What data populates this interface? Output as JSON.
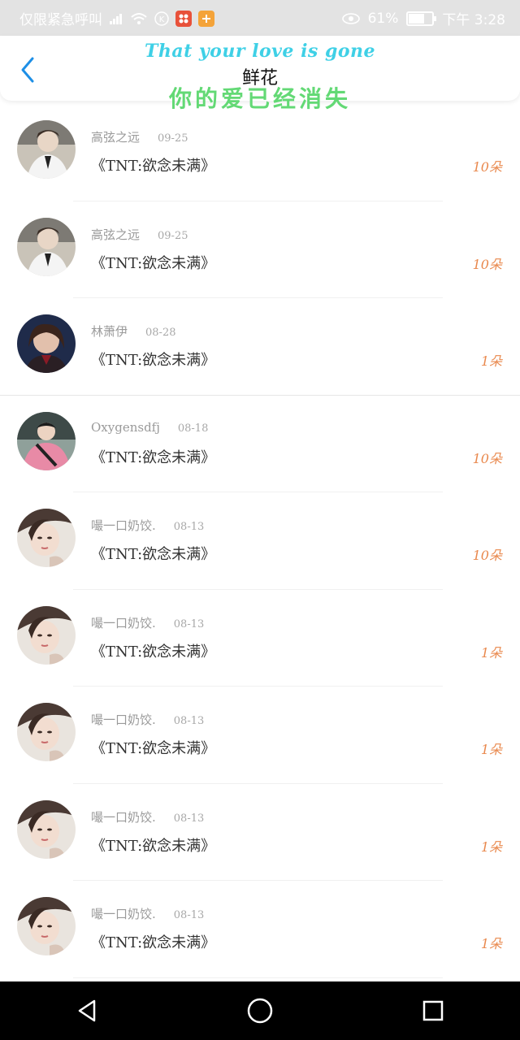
{
  "status_bar": {
    "carrier": "仅限紧急呼叫",
    "battery_text": "61%",
    "battery_level": 0.61,
    "time": "下午 3:28",
    "icons": [
      "signal-icon",
      "wifi-icon",
      "k-circle-icon",
      "app-badge-red",
      "app-badge-orange",
      "eye-icon",
      "battery-icon"
    ]
  },
  "header": {
    "title_en": "That your love is gone",
    "title": "鲜花",
    "title_cn": "你的爱已经消失",
    "accent_colors": {
      "en": "#3fd0e6",
      "cn": "#63d975",
      "back": "#1e8fe6"
    }
  },
  "items": [
    {
      "name": "高弦之远",
      "date": "09-25",
      "song": "《TNT:欲念未满》",
      "count": "10朵",
      "avatar": "avatar-1"
    },
    {
      "name": "高弦之远",
      "date": "09-25",
      "song": "《TNT:欲念未满》",
      "count": "10朵",
      "avatar": "avatar-1"
    },
    {
      "name": "林萧伊",
      "date": "08-28",
      "song": "《TNT:欲念未满》",
      "count": "1朵",
      "avatar": "avatar-2"
    },
    {
      "name": "Oxygensdfj",
      "date": "08-18",
      "song": "《TNT:欲念未满》",
      "count": "10朵",
      "avatar": "avatar-3"
    },
    {
      "name": "嘬一口奶饺.",
      "date": "08-13",
      "song": "《TNT:欲念未满》",
      "count": "10朵",
      "avatar": "avatar-4"
    },
    {
      "name": "嘬一口奶饺.",
      "date": "08-13",
      "song": "《TNT:欲念未满》",
      "count": "1朵",
      "avatar": "avatar-4"
    },
    {
      "name": "嘬一口奶饺.",
      "date": "08-13",
      "song": "《TNT:欲念未满》",
      "count": "1朵",
      "avatar": "avatar-4"
    },
    {
      "name": "嘬一口奶饺.",
      "date": "08-13",
      "song": "《TNT:欲念未满》",
      "count": "1朵",
      "avatar": "avatar-4"
    },
    {
      "name": "嘬一口奶饺.",
      "date": "08-13",
      "song": "《TNT:欲念未满》",
      "count": "1朵",
      "avatar": "avatar-4"
    }
  ],
  "nav_bar": {
    "icons": [
      "back-triangle-icon",
      "home-circle-icon",
      "recents-square-icon"
    ]
  }
}
